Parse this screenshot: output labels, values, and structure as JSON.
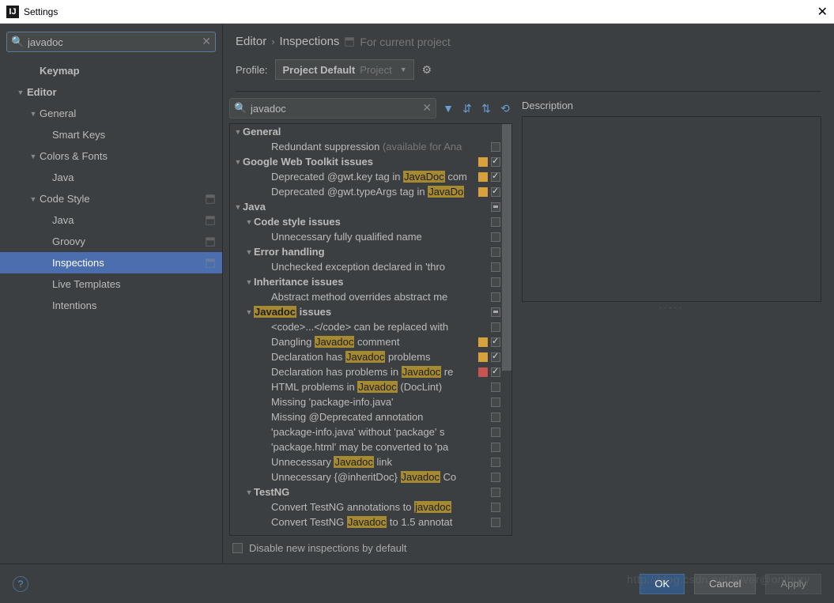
{
  "window": {
    "title": "Settings"
  },
  "search": {
    "value": "javadoc"
  },
  "sidebar": {
    "items": [
      {
        "label": "Keymap",
        "depth": 2,
        "bold": true,
        "arrow": ""
      },
      {
        "label": "Editor",
        "depth": 1,
        "bold": true,
        "arrow": "▼"
      },
      {
        "label": "General",
        "depth": 2,
        "arrow": "▼"
      },
      {
        "label": "Smart Keys",
        "depth": 3,
        "arrow": ""
      },
      {
        "label": "Colors & Fonts",
        "depth": 2,
        "arrow": "▼"
      },
      {
        "label": "Java",
        "depth": 3,
        "arrow": ""
      },
      {
        "label": "Code Style",
        "depth": 2,
        "arrow": "▼",
        "badge": true
      },
      {
        "label": "Java",
        "depth": 3,
        "arrow": "",
        "badge": true
      },
      {
        "label": "Groovy",
        "depth": 3,
        "arrow": "",
        "badge": true
      },
      {
        "label": "Inspections",
        "depth": 3,
        "arrow": "",
        "badge": true,
        "selected": true
      },
      {
        "label": "Live Templates",
        "depth": 3,
        "arrow": ""
      },
      {
        "label": "Intentions",
        "depth": 3,
        "arrow": ""
      }
    ]
  },
  "breadcrumb": {
    "a": "Editor",
    "b": "Inspections",
    "sub": "For current project"
  },
  "profile": {
    "label": "Profile:",
    "name": "Project Default",
    "scope": "Project"
  },
  "filter": {
    "value": "javadoc"
  },
  "disable_label": "Disable new inspections by default",
  "description_label": "Description",
  "buttons": {
    "ok": "OK",
    "cancel": "Cancel",
    "apply": "Apply"
  },
  "watermark": "http://blog.csdn.net/River@onlbury",
  "inspections": [
    {
      "ind": 0,
      "arrow": "▼",
      "bold": true,
      "parts": [
        [
          "General",
          ""
        ]
      ],
      "cb": "none"
    },
    {
      "ind": 2,
      "parts": [
        [
          "Redundant suppression ",
          ""
        ],
        [
          "(available for Ana",
          "dim"
        ]
      ],
      "cb": "off"
    },
    {
      "ind": 0,
      "arrow": "▼",
      "bold": true,
      "parts": [
        [
          "Google Web Toolkit issues",
          ""
        ]
      ],
      "sev": "warn",
      "cb": "on"
    },
    {
      "ind": 2,
      "parts": [
        [
          "Deprecated @gwt.key tag in ",
          ""
        ],
        [
          "JavaDoc",
          "hl"
        ],
        [
          " com",
          ""
        ]
      ],
      "sev": "warn",
      "cb": "on"
    },
    {
      "ind": 2,
      "parts": [
        [
          "Deprecated @gwt.typeArgs tag in ",
          ""
        ],
        [
          "JavaDo",
          "hl"
        ]
      ],
      "sev": "warn",
      "cb": "on"
    },
    {
      "ind": 0,
      "arrow": "▼",
      "bold": true,
      "parts": [
        [
          "Java",
          ""
        ]
      ],
      "cb": "mixed"
    },
    {
      "ind": 1,
      "arrow": "▼",
      "bold": true,
      "parts": [
        [
          "Code style issues",
          ""
        ]
      ],
      "cb": "off"
    },
    {
      "ind": 2,
      "parts": [
        [
          "Unnecessary fully qualified name",
          ""
        ]
      ],
      "cb": "off"
    },
    {
      "ind": 1,
      "arrow": "▼",
      "bold": true,
      "parts": [
        [
          "Error handling",
          ""
        ]
      ],
      "cb": "off"
    },
    {
      "ind": 2,
      "parts": [
        [
          "Unchecked exception declared in 'thro",
          ""
        ]
      ],
      "cb": "off"
    },
    {
      "ind": 1,
      "arrow": "▼",
      "bold": true,
      "parts": [
        [
          "Inheritance issues",
          ""
        ]
      ],
      "cb": "off"
    },
    {
      "ind": 2,
      "parts": [
        [
          "Abstract method overrides abstract me",
          ""
        ]
      ],
      "cb": "off"
    },
    {
      "ind": 1,
      "arrow": "▼",
      "bold": true,
      "parts": [
        [
          "Javadoc",
          "hl"
        ],
        [
          " issues",
          ""
        ]
      ],
      "cb": "mixed"
    },
    {
      "ind": 2,
      "parts": [
        [
          "<code>...</code> can be replaced with",
          ""
        ]
      ],
      "cb": "off"
    },
    {
      "ind": 2,
      "parts": [
        [
          "Dangling ",
          ""
        ],
        [
          "Javadoc",
          "hl"
        ],
        [
          " comment",
          ""
        ]
      ],
      "sev": "warn",
      "cb": "on"
    },
    {
      "ind": 2,
      "parts": [
        [
          "Declaration has ",
          ""
        ],
        [
          "Javadoc",
          "hl"
        ],
        [
          " problems",
          ""
        ]
      ],
      "sev": "warn",
      "cb": "on"
    },
    {
      "ind": 2,
      "parts": [
        [
          "Declaration has problems in ",
          ""
        ],
        [
          "Javadoc",
          "hl"
        ],
        [
          " re",
          ""
        ]
      ],
      "sev": "err",
      "cb": "on"
    },
    {
      "ind": 2,
      "parts": [
        [
          "HTML problems in ",
          ""
        ],
        [
          "Javadoc",
          "hl"
        ],
        [
          " (DocLint)",
          ""
        ]
      ],
      "cb": "off"
    },
    {
      "ind": 2,
      "parts": [
        [
          "Missing 'package-info.java'",
          ""
        ]
      ],
      "cb": "off"
    },
    {
      "ind": 2,
      "parts": [
        [
          "Missing @Deprecated annotation",
          ""
        ]
      ],
      "cb": "off"
    },
    {
      "ind": 2,
      "parts": [
        [
          "'package-info.java' without 'package' s",
          ""
        ]
      ],
      "cb": "off"
    },
    {
      "ind": 2,
      "parts": [
        [
          "'package.html' may be converted to 'pa",
          ""
        ]
      ],
      "cb": "off"
    },
    {
      "ind": 2,
      "parts": [
        [
          "Unnecessary ",
          ""
        ],
        [
          "Javadoc",
          "hl"
        ],
        [
          " link",
          ""
        ]
      ],
      "cb": "off"
    },
    {
      "ind": 2,
      "parts": [
        [
          "Unnecessary {@inheritDoc} ",
          ""
        ],
        [
          "Javadoc",
          "hl"
        ],
        [
          " Co",
          ""
        ]
      ],
      "cb": "off"
    },
    {
      "ind": 1,
      "arrow": "▼",
      "bold": true,
      "parts": [
        [
          "TestNG",
          ""
        ]
      ],
      "cb": "off"
    },
    {
      "ind": 2,
      "parts": [
        [
          "Convert TestNG annotations to ",
          ""
        ],
        [
          "javadoc",
          "hl"
        ]
      ],
      "cb": "off"
    },
    {
      "ind": 2,
      "parts": [
        [
          "Convert TestNG ",
          ""
        ],
        [
          "Javadoc",
          "hl"
        ],
        [
          " to 1.5 annotat",
          ""
        ]
      ],
      "cb": "off"
    }
  ]
}
